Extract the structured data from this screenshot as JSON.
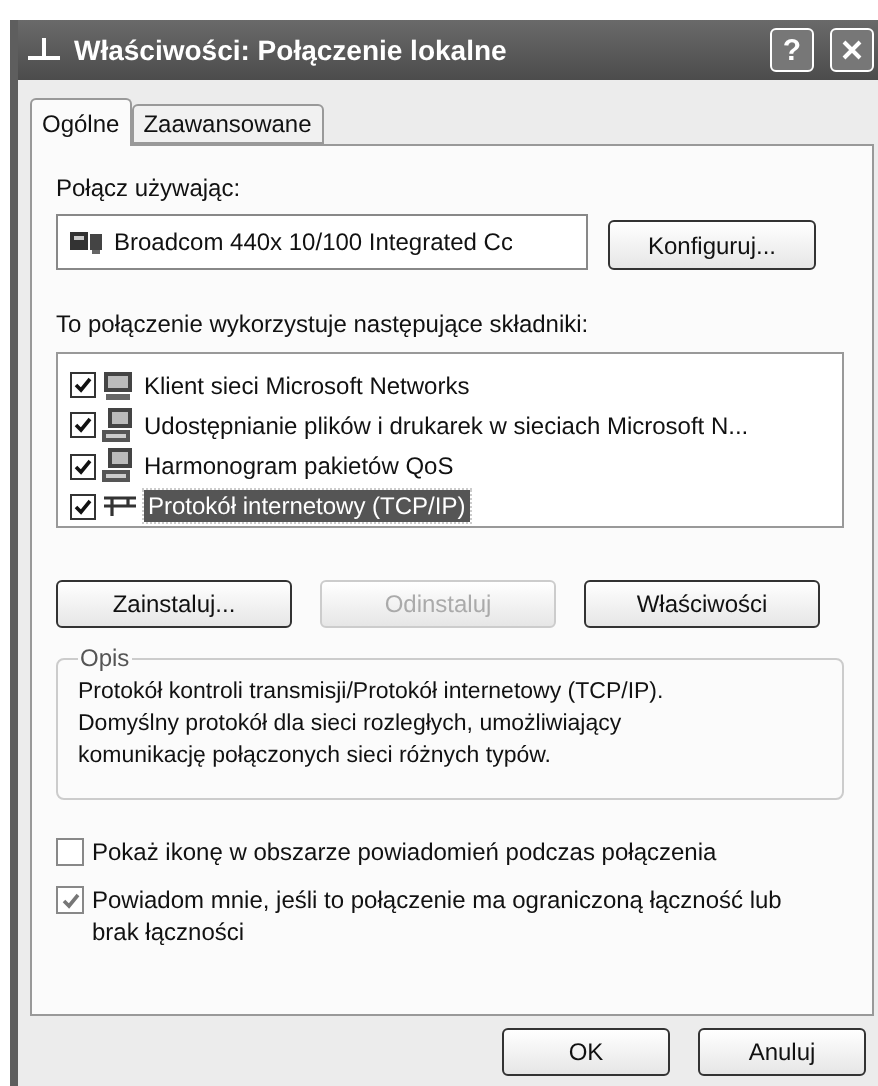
{
  "window": {
    "title": "Właściwości: Połączenie lokalne"
  },
  "title_buttons": [
    {
      "kind": "help",
      "label": "?"
    },
    {
      "kind": "close"
    }
  ],
  "tabs": [
    {
      "label": "Ogólne",
      "selected": true
    },
    {
      "label": "Zaawansowane",
      "selected": false
    }
  ],
  "connect_using": {
    "label": "Połącz używając:",
    "adapter": "Broadcom 440x 10/100 Integrated Cc",
    "button": "Konfiguruj..."
  },
  "components": {
    "label": "To połączenie wykorzystuje następujące składniki:",
    "items": [
      {
        "kind": "client",
        "label": "Klient sieci Microsoft Networks",
        "checked": true,
        "selected": false
      },
      {
        "kind": "service",
        "label": "Udostępnianie plików i drukarek w sieciach Microsoft N...",
        "checked": true,
        "selected": false
      },
      {
        "kind": "service",
        "label": "Harmonogram pakietów QoS",
        "checked": true,
        "selected": false
      },
      {
        "kind": "protocol",
        "label": "Protokół internetowy (TCP/IP)",
        "checked": true,
        "selected": true
      }
    ]
  },
  "component_buttons": [
    {
      "label": "Zainstaluj...",
      "disabled": false
    },
    {
      "label": "Odinstaluj",
      "disabled": true
    },
    {
      "label": "Właściwości",
      "disabled": false
    }
  ],
  "description": {
    "title": "Opis",
    "text": "Protokół kontroli transmisji/Protokół internetowy (TCP/IP). Domyślny protokół dla sieci rozległych, umożliwiający komunikację połączonych sieci różnych typów."
  },
  "options": [
    {
      "label": "Pokaż ikonę w obszarze powiadomień podczas połączenia",
      "checked": false
    },
    {
      "label": "Powiadom mnie, jeśli to połączenie ma ograniczoną łączność lub brak łączności",
      "checked": true
    }
  ],
  "dialog_buttons": [
    "OK",
    "Anuluj"
  ]
}
